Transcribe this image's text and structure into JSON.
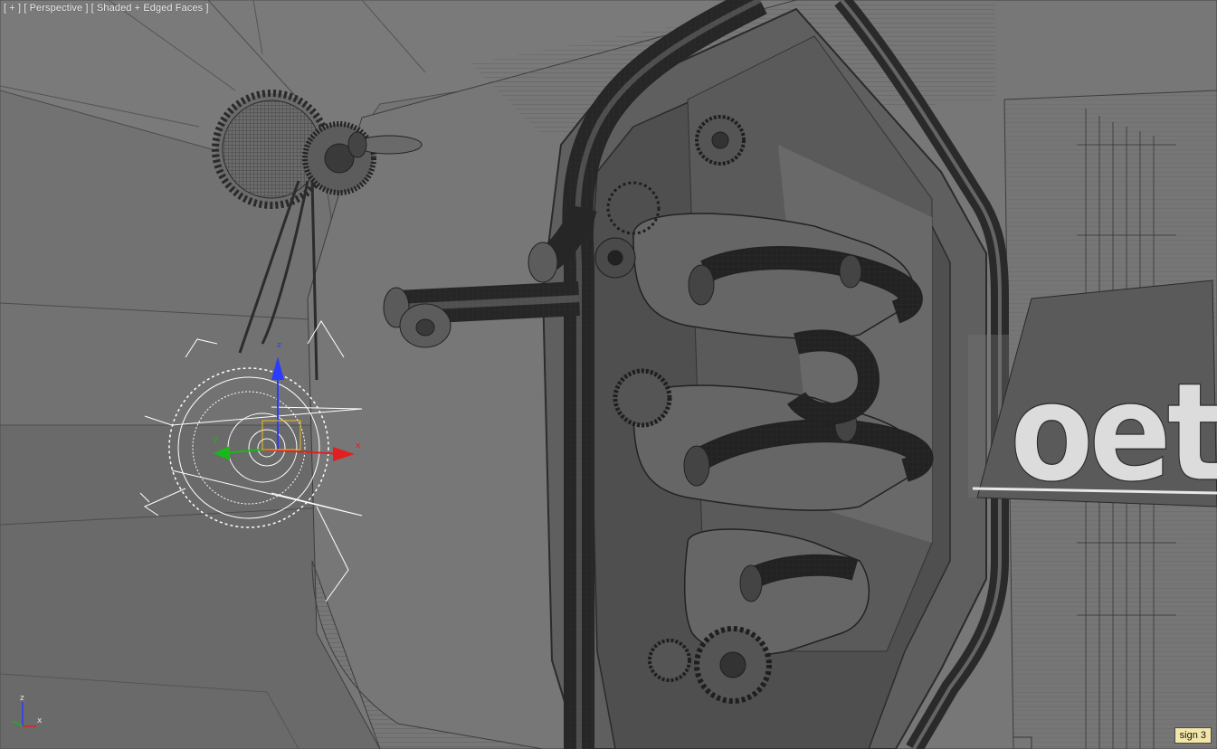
{
  "viewport": {
    "label_parts": [
      "[ + ]",
      "[ Perspective ]",
      "[ Shaded + Edged Faces ]"
    ]
  },
  "gizmo": {
    "axis_x": "x",
    "axis_y": "y",
    "axis_z": "z"
  },
  "world_axis": {
    "axis_x": "x",
    "axis_z": "z"
  },
  "status": {
    "selection_name": "sign 3"
  },
  "sign": {
    "letters_text": "oetbe"
  },
  "colors": {
    "background": "#6f6f6f",
    "axis_x": "#e02020",
    "axis_y": "#18b818",
    "axis_z": "#2a3cff",
    "selection_wire": "#ffffff",
    "badge": "#f3e6a9"
  }
}
